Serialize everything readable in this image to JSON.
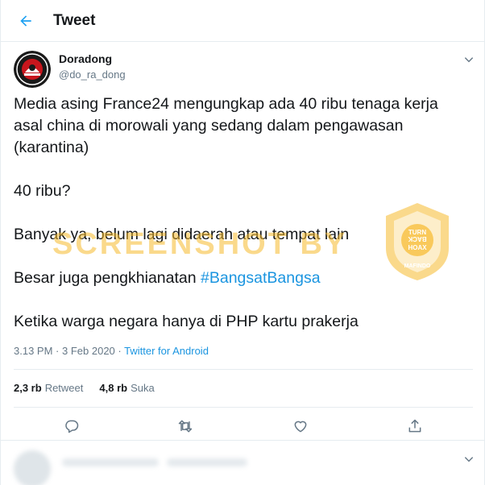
{
  "header": {
    "title": "Tweet"
  },
  "author": {
    "name": "Doradong",
    "handle": "@do_ra_dong"
  },
  "tweet": {
    "lines": [
      "Media asing France24 mengungkap ada 40 ribu tenaga kerja",
      "asal china di morowali yang sedang dalam pengawasan",
      "(karantina)"
    ],
    "p2": "40 ribu?",
    "p3": "Banyak ya, belum lagi didaerah atau tempat lain",
    "p4_prefix": "Besar juga pengkhianatan ",
    "p4_hashtag": "#BangsatBangsa",
    "p5": "Ketika warga negara hanya di PHP kartu prakerja"
  },
  "meta": {
    "time": "3.13 PM",
    "date": "3 Feb 2020",
    "separator": "·",
    "source": "Twitter for Android"
  },
  "stats": {
    "retweets_count": "2,3 rb",
    "retweets_label": "Retweet",
    "likes_count": "4,8 rb",
    "likes_label": "Suka"
  },
  "watermark": {
    "text": "SCREENSHOT BY",
    "seal_ring": "MASYARAKAT ANTI FITNAH INDONESIA",
    "seal_center_1": "TURN",
    "seal_center_2": "BACK",
    "seal_center_3": "HOAX",
    "seal_bottom": "MAFINDO"
  },
  "colors": {
    "accent": "#1da1f2",
    "link": "#1b95e0",
    "text": "#14171a",
    "muted": "#657786",
    "border": "#e6ecf0",
    "watermark": "#f6b92c"
  },
  "icons": [
    "back-arrow-icon",
    "chevron-down-icon",
    "reply-icon",
    "retweet-icon",
    "like-icon",
    "share-icon"
  ]
}
